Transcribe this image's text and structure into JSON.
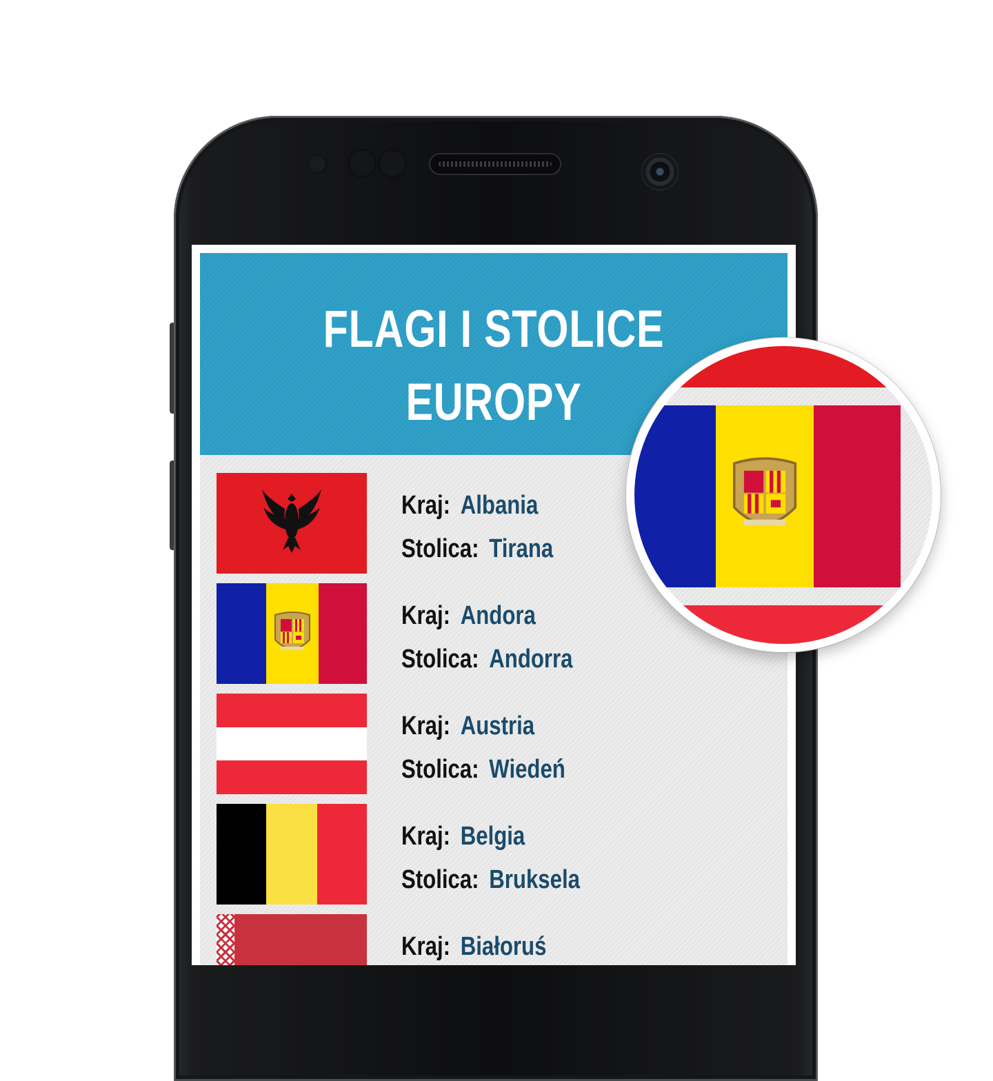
{
  "header": {
    "title_line1": "FLAGI I STOLICE",
    "title_line2": "EUROPY"
  },
  "labels": {
    "country": "Kraj:",
    "capital": "Stolica:"
  },
  "countries": [
    {
      "country": "Albania",
      "capital": "Tirana"
    },
    {
      "country": "Andora",
      "capital": "Andorra"
    },
    {
      "country": "Austria",
      "capital": "Wiedeń"
    },
    {
      "country": "Belgia",
      "capital": "Bruksela"
    },
    {
      "country": "Białoruś",
      "capital": ""
    }
  ],
  "magnifier": {
    "subject": "Andora"
  },
  "colors": {
    "header_bg": "#2b9cc4",
    "value_text": "#1b4b6b",
    "red": "#e31b23",
    "blue": "#1021a8",
    "yellow": "#fedf00",
    "crimson": "#d0103a"
  },
  "icons": [
    "eagle-icon",
    "coat-of-arms-icon",
    "ornament-icon"
  ]
}
